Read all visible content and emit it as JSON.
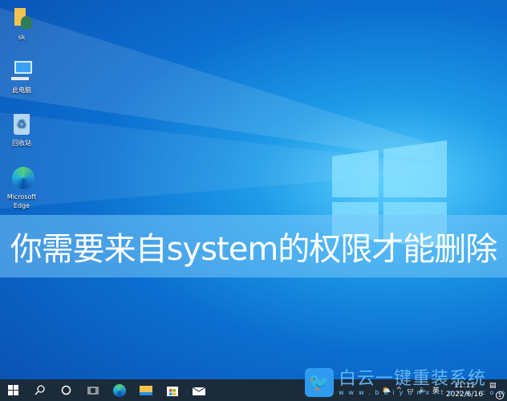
{
  "desktop": {
    "icons": [
      {
        "label": "sk",
        "icon": "user-folder-icon"
      },
      {
        "label": "此电脑",
        "icon": "computer-icon"
      },
      {
        "label": "回收站",
        "icon": "recycle-bin-icon"
      },
      {
        "label": "Microsoft Edge",
        "icon": "edge-icon"
      }
    ]
  },
  "banner": {
    "text": "你需要来自system的权限才能删除"
  },
  "watermark": {
    "title": "白云一键重装系统",
    "url": "www.baiyunxitong.com"
  },
  "taskbar": {
    "items": [
      "start-icon",
      "search-icon",
      "cortana-icon",
      "task-view-icon",
      "edge-icon",
      "file-explorer-icon",
      "store-icon",
      "mail-icon"
    ],
    "tray": {
      "ime": "英",
      "time": "11:11",
      "date": "2022/6/16",
      "notifications": "1"
    }
  },
  "colors": {
    "taskbar": "#1b2b3a",
    "banner": "#78c8fa"
  }
}
